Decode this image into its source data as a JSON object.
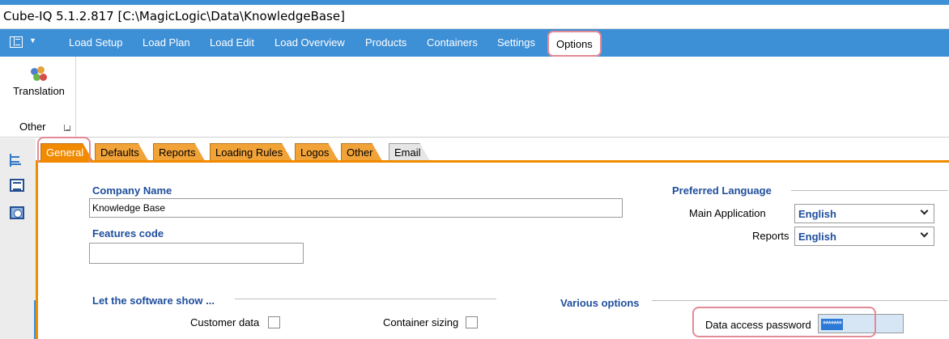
{
  "window": {
    "title": "Cube-IQ  5.1.2.817  [C:\\MagicLogic\\Data\\KnowledgeBase]"
  },
  "menubar": {
    "items": [
      {
        "label": "Load Setup"
      },
      {
        "label": "Load Plan"
      },
      {
        "label": "Load Edit"
      },
      {
        "label": "Load Overview"
      },
      {
        "label": "Products"
      },
      {
        "label": "Containers"
      },
      {
        "label": "Settings"
      },
      {
        "label": "Options",
        "active": true
      }
    ]
  },
  "ribbon": {
    "translation_label": "Translation",
    "group_label": "Other"
  },
  "tabs": [
    {
      "label": "General",
      "active": true
    },
    {
      "label": "Defaults"
    },
    {
      "label": "Reports"
    },
    {
      "label": "Loading Rules"
    },
    {
      "label": "Logos"
    },
    {
      "label": "Other"
    },
    {
      "label": "Email"
    }
  ],
  "general": {
    "company_name_label": "Company Name",
    "company_name_value": "Knowledge Base",
    "features_code_label": "Features code",
    "features_code_value": "",
    "preferred_language_label": "Preferred Language",
    "main_application_label": "Main Application",
    "main_application_value": "English",
    "reports_label": "Reports",
    "reports_value": "English",
    "show_section_label": "Let the software show ...",
    "customer_data_label": "Customer data",
    "container_sizing_label": "Container sizing",
    "various_options_label": "Various options",
    "data_access_password_label": "Data access password",
    "data_access_password_value": "*******"
  },
  "colors": {
    "accent": "#3d8fd6",
    "tab_orange": "#f28a00",
    "section_blue": "#1f4e9c",
    "highlight_outline": "#e28a96"
  }
}
